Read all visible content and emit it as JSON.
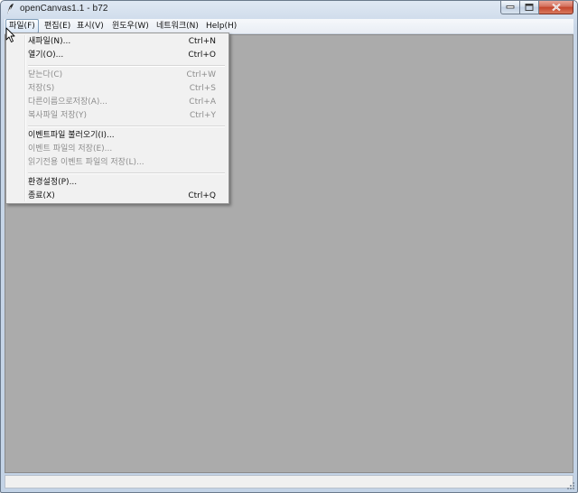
{
  "window": {
    "title": "openCanvas1.1 - b72"
  },
  "menubar": {
    "items": [
      {
        "label": "파일(F)"
      },
      {
        "label": "편집(E)"
      },
      {
        "label": "표시(V)"
      },
      {
        "label": "윈도우(W)"
      },
      {
        "label": "네트워크(N)"
      },
      {
        "label": "Help(H)"
      }
    ]
  },
  "file_menu": {
    "groups": [
      [
        {
          "label": "새파일(N)...",
          "shortcut": "Ctrl+N",
          "enabled": true
        },
        {
          "label": "열기(O)...",
          "shortcut": "Ctrl+O",
          "enabled": true
        }
      ],
      [
        {
          "label": "닫는다(C)",
          "shortcut": "Ctrl+W",
          "enabled": false
        },
        {
          "label": "저장(S)",
          "shortcut": "Ctrl+S",
          "enabled": false
        },
        {
          "label": "다른이름으로저장(A)...",
          "shortcut": "Ctrl+A",
          "enabled": false
        },
        {
          "label": "복사파일 저장(Y)",
          "shortcut": "Ctrl+Y",
          "enabled": false
        }
      ],
      [
        {
          "label": "이벤트파일 불러오기(I)...",
          "shortcut": "",
          "enabled": true
        },
        {
          "label": "이벤트 파일의 저장(E)...",
          "shortcut": "",
          "enabled": false
        },
        {
          "label": "읽기전용 이벤트 파일의 저장(L)...",
          "shortcut": "",
          "enabled": false
        }
      ],
      [
        {
          "label": "환경설정(P)...",
          "shortcut": "",
          "enabled": true
        },
        {
          "label": "종료(X)",
          "shortcut": "Ctrl+Q",
          "enabled": true
        }
      ]
    ]
  },
  "colors": {
    "canvas_bg": "#ababab",
    "disabled_text": "#8d8d8d",
    "menu_bg": "#f1f1f1"
  },
  "icons": {
    "app": "feather-pen-icon",
    "minimize": "minimize-icon",
    "maximize": "maximize-icon",
    "close": "close-icon",
    "resize": "resize-grip-icon",
    "cursor": "mouse-pointer-icon"
  }
}
